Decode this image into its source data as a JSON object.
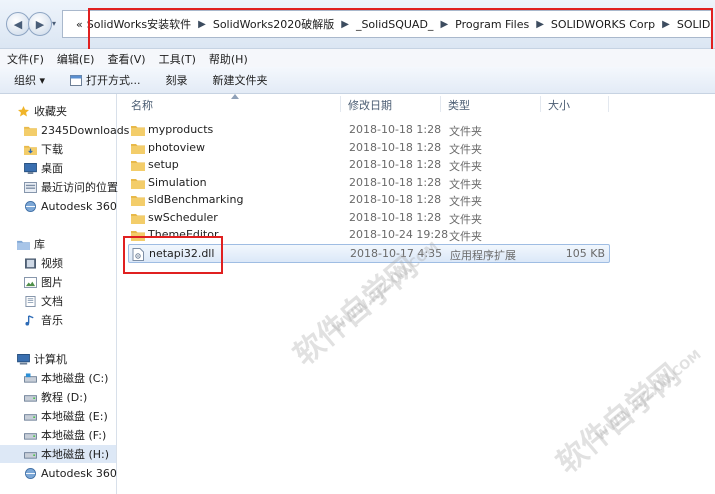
{
  "address": {
    "overflow": "«",
    "segments": [
      "SolidWorks安装软件",
      "SolidWorks2020破解版",
      "_SolidSQUAD_",
      "Program Files",
      "SOLIDWORKS Corp",
      "SOLIDWORKS"
    ]
  },
  "menu": [
    "文件(F)",
    "编辑(E)",
    "查看(V)",
    "工具(T)",
    "帮助(H)"
  ],
  "toolbar": {
    "organize": "组织 ▾",
    "open_with": "打开方式...",
    "burn": "刻录",
    "new_folder": "新建文件夹"
  },
  "sidebar": {
    "favorites_header": "收藏夹",
    "favorites": [
      "2345Downloads",
      "下载",
      "桌面",
      "最近访问的位置",
      "Autodesk 360"
    ],
    "libraries_header": "库",
    "libraries": [
      "视频",
      "图片",
      "文档",
      "音乐"
    ],
    "computer_header": "计算机",
    "drives": [
      "本地磁盘 (C:)",
      "教程 (D:)",
      "本地磁盘 (E:)",
      "本地磁盘 (F:)",
      "本地磁盘 (H:)",
      "Autodesk 360"
    ]
  },
  "columns": {
    "name": "名称",
    "date": "修改日期",
    "type": "类型",
    "size": "大小"
  },
  "files": [
    {
      "name": "myproducts",
      "date": "2018-10-18 1:28",
      "type": "文件夹",
      "size": ""
    },
    {
      "name": "photoview",
      "date": "2018-10-18 1:28",
      "type": "文件夹",
      "size": ""
    },
    {
      "name": "setup",
      "date": "2018-10-18 1:28",
      "type": "文件夹",
      "size": ""
    },
    {
      "name": "Simulation",
      "date": "2018-10-18 1:28",
      "type": "文件夹",
      "size": ""
    },
    {
      "name": "sldBenchmarking",
      "date": "2018-10-18 1:28",
      "type": "文件夹",
      "size": ""
    },
    {
      "name": "swScheduler",
      "date": "2018-10-18 1:28",
      "type": "文件夹",
      "size": ""
    },
    {
      "name": "ThemeEditor",
      "date": "2018-10-24 19:28",
      "type": "文件夹",
      "size": ""
    },
    {
      "name": "netapi32.dll",
      "date": "2018-10-17 4:35",
      "type": "应用程序扩展",
      "size": "105 KB"
    }
  ],
  "watermark": {
    "cn": "软件自学网",
    "url": "WWW.RJZXW.COM"
  },
  "colors": {
    "accent": "#3c7fb1",
    "highlight": "#e02020",
    "folder": "#e8b94a"
  }
}
